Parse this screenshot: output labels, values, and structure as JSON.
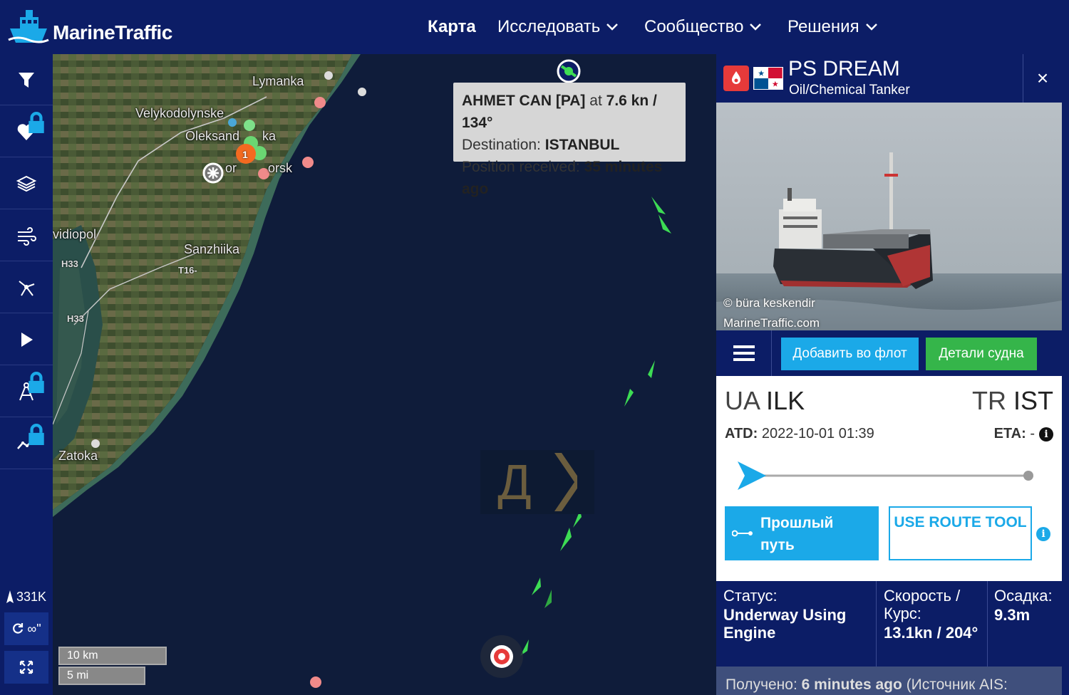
{
  "app": {
    "brand": "MarineTraffic"
  },
  "nav": {
    "items": [
      {
        "label": "Карта",
        "dropdown": false
      },
      {
        "label": "Исследовать",
        "dropdown": true
      },
      {
        "label": "Сообщество",
        "dropdown": true
      },
      {
        "label": "Решения",
        "dropdown": true
      }
    ]
  },
  "sidebar": {
    "tools": [
      {
        "icon": "filter-icon",
        "locked": false
      },
      {
        "icon": "heart-icon",
        "locked": true
      },
      {
        "icon": "layers-icon",
        "locked": false
      },
      {
        "icon": "wind-icon",
        "locked": false
      },
      {
        "icon": "network-icon",
        "locked": false
      },
      {
        "icon": "play-icon",
        "locked": false
      },
      {
        "icon": "measure-icon",
        "locked": true
      },
      {
        "icon": "analytics-icon",
        "locked": true
      }
    ],
    "vessel_count": "331K",
    "loop_label": "∞\"",
    "fullscreen_icon": "fullscreen-icon"
  },
  "map": {
    "places": [
      "Lymanka",
      "Velykodolynske",
      "Oleksandrivka",
      "Chornomorsk",
      "Ovidiopol",
      "Sanzhiika",
      "Zatoka"
    ],
    "place_labels": {
      "lymanka": "Lymanka",
      "velyko": "Velykodolynske",
      "oleks_a": "Oleksand",
      "oleks_b": "ka",
      "chorno_a": "or",
      "chorno_b": "orsk",
      "ovidio": "vidiopol",
      "sanzh": "Sanzhiika",
      "zatoka": "Zatoka"
    },
    "roads": [
      "H33",
      "T16-",
      "H33"
    ],
    "cluster_count": "1",
    "tooltip": {
      "vessel": "AHMET CAN [PA]",
      "at": "at",
      "speed_course": "7.6 kn / 134°",
      "destination_label": "Destination:",
      "destination": "ISTANBUL",
      "position_label": "Position received:",
      "position_age": "35 minutes ago"
    },
    "scale": {
      "km": "10 km",
      "mi": "5 mi"
    },
    "promo_letter": "Д"
  },
  "panel": {
    "vessel_name": "PS DREAM",
    "vessel_type": "Oil/Chemical Tanker",
    "flag": "Panama",
    "close_label": "×",
    "photo_credit_line1": "© büra keskendir",
    "photo_credit_line2": "MarineTraffic.com",
    "add_fleet_label": "Добавить во флот",
    "details_label": "Детали судна",
    "route": {
      "dep_country": "UA",
      "dep_port": "ILK",
      "arr_country": "TR",
      "arr_port": "IST",
      "atd_label": "ATD:",
      "atd_value": "2022-10-01 01:39",
      "eta_label": "ETA:",
      "eta_value": "-",
      "progress": 0.0
    },
    "past_track_label": "Прошлый путь",
    "route_tool_label": "USE ROUTE TOOL",
    "stats": {
      "status_label": "Статус:",
      "status_value": "Underway Using Engine",
      "speed_label": "Скорость / Курс:",
      "speed_value": "13.1kn / 204°",
      "draught_label": "Осадка:",
      "draught_value": "9.3m"
    },
    "received_label": "Получено:",
    "received_value": "6 minutes ago",
    "received_source": "(Источник AIS:"
  },
  "colors": {
    "navy": "#0c1d66",
    "blue_button": "#1ba9e8",
    "green_button": "#35b54a",
    "vessel_green": "#3ddc54",
    "sea": "#0f1c3a"
  }
}
